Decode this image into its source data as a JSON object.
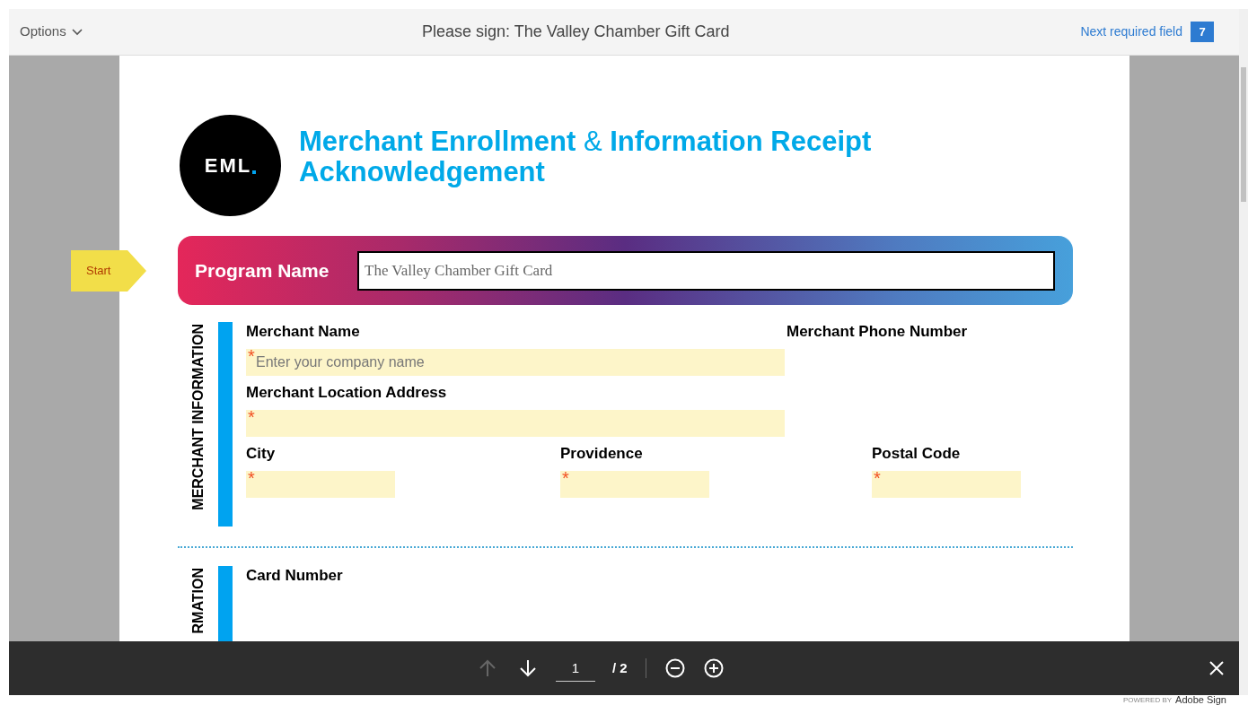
{
  "header": {
    "options_label": "Options",
    "title": "Please sign: The Valley Chamber Gift Card",
    "next_field_label": "Next required field",
    "required_count": "7"
  },
  "document": {
    "logo_text": "EML",
    "title_lines": [
      "**Merchant Enrollment** & **Information Receipt**",
      "**Acknowledgement**"
    ],
    "start_tag": "Start",
    "program": {
      "label": "Program Name",
      "value": "The Valley Chamber Gift Card"
    },
    "sections": [
      {
        "title": "MERCHANT INFORMATION",
        "rows": [
          {
            "fields": [
              {
                "label": "Merchant Name",
                "field": {
                  "marker": "*",
                  "placeholder": "Enter your company name"
                }
              },
              {
                "label": "Merchant Phone Number"
              }
            ]
          },
          {
            "fields": [
              {
                "label": "Merchant Location Address",
                "field": {
                  "marker": "*"
                }
              }
            ]
          },
          {
            "fields": [
              {
                "label": "City",
                "field": {
                  "marker": "*"
                }
              },
              {
                "label": "Providence",
                "field": {
                  "marker": "*"
                }
              },
              {
                "label": "Postal Code",
                "field": {
                  "marker": "*"
                }
              }
            ]
          }
        ]
      },
      {
        "title": "RMATION",
        "rows": [
          {
            "fields": [
              {
                "label": "Card Number"
              }
            ]
          }
        ]
      }
    ]
  },
  "toolbar": {
    "previous_disabled": true,
    "page_value": "1",
    "page_total": "/ 2"
  },
  "footer": {
    "powered_by": "POWERED BY",
    "brand": "Adobe Sign"
  }
}
